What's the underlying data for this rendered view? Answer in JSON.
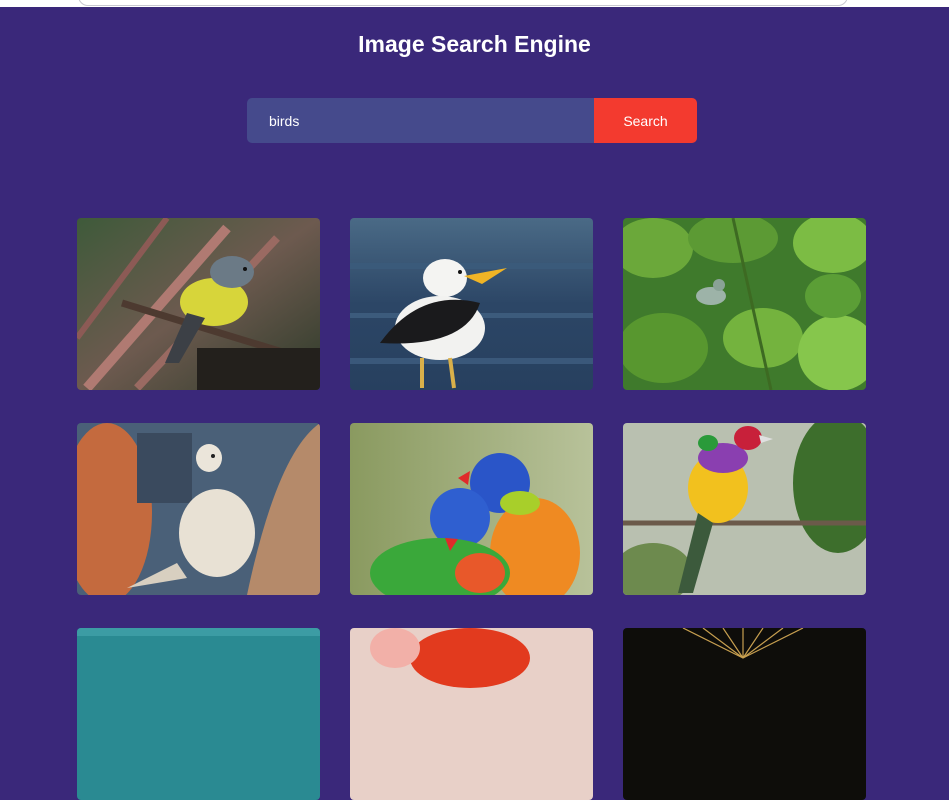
{
  "page": {
    "title": "Image Search Engine"
  },
  "search": {
    "value": "birds",
    "button_label": "Search"
  },
  "results": [
    {
      "name": "yellow-robin-photo"
    },
    {
      "name": "seagull-photo"
    },
    {
      "name": "warbler-in-leaves-photo"
    },
    {
      "name": "dove-photo"
    },
    {
      "name": "rainbow-lorikeets-photo"
    },
    {
      "name": "gouldian-finch-photo"
    },
    {
      "name": "water-photo"
    },
    {
      "name": "flamingo-photo"
    },
    {
      "name": "fireworks-bird-photo"
    }
  ]
}
